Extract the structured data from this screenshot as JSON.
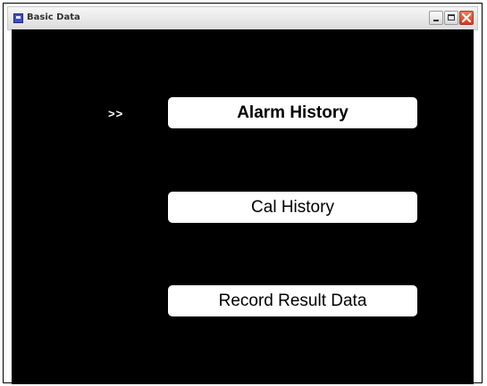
{
  "window": {
    "title": "Basic Data",
    "icon": "app-window-icon",
    "controls": [
      "minimize-icon",
      "maximize-icon",
      "close-icon"
    ],
    "colors": {
      "client_background": "#000000",
      "button_background": "#ffffff",
      "close_button": "#d23a1f"
    }
  },
  "menu": {
    "selection_indicator": ">>",
    "selected_index": 0,
    "items": [
      {
        "label": "Alarm History"
      },
      {
        "label": "Cal History"
      },
      {
        "label": "Record Result Data"
      }
    ]
  }
}
